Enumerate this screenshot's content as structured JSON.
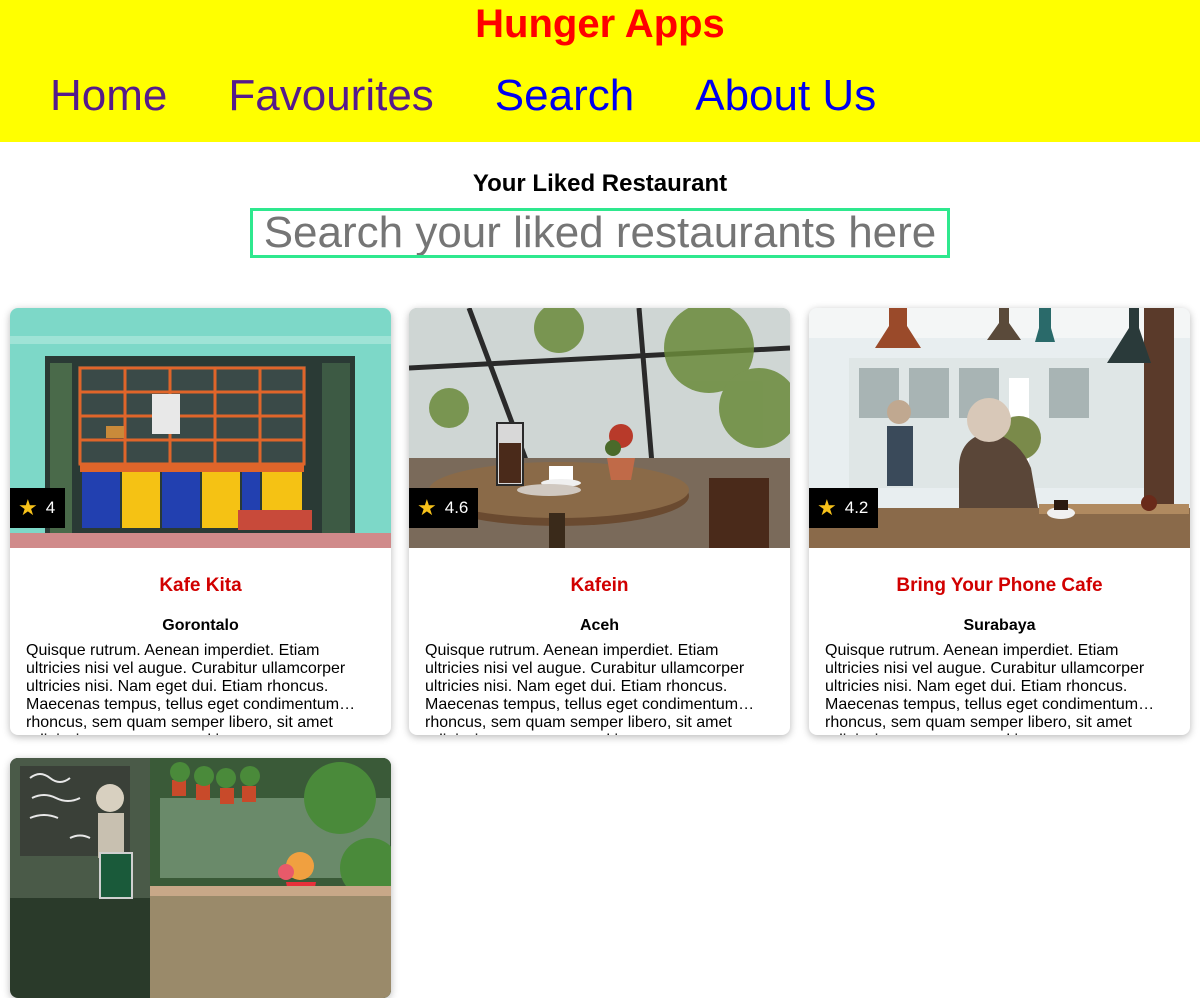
{
  "header": {
    "title": "Hunger Apps",
    "nav": [
      {
        "label": "Home",
        "state": "visited"
      },
      {
        "label": "Favourites",
        "state": "visited"
      },
      {
        "label": "Search",
        "state": "unvisited"
      },
      {
        "label": "About Us",
        "state": "unvisited"
      }
    ],
    "background_color": "#ffff00",
    "title_color": "#ff0000"
  },
  "main": {
    "title": "Your Liked Restaurant",
    "search": {
      "placeholder": "Search your liked restaurants here",
      "value": ""
    },
    "restaurants": [
      {
        "name": "Kafe Kita",
        "city": "Gorontalo",
        "rating": "4",
        "description": "Quisque rutrum. Aenean imperdiet. Etiam ultricies nisi vel augue. Curabitur ullamcorper ultricies nisi. Nam eget dui. Etiam rhoncus. Maecenas tempus, tellus eget condimentum rhoncus, sem quam semper libero, sit amet adipiscing sem neque sed ipsum."
      },
      {
        "name": "Kafein",
        "city": "Aceh",
        "rating": "4.6",
        "description": "Quisque rutrum. Aenean imperdiet. Etiam ultricies nisi vel augue. Curabitur ullamcorper ultricies nisi. Nam eget dui. Etiam rhoncus. Maecenas tempus, tellus eget condimentum rhoncus, sem quam semper libero, sit amet adipiscing sem neque sed ipsum."
      },
      {
        "name": "Bring Your Phone Cafe",
        "city": "Surabaya",
        "rating": "4.2",
        "description": "Quisque rutrum. Aenean imperdiet. Etiam ultricies nisi vel augue. Curabitur ullamcorper ultricies nisi. Nam eget dui. Etiam rhoncus. Maecenas tempus, tellus eget condimentum rhoncus, sem quam semper libero, sit amet adipiscing sem neque sed ipsum."
      },
      {
        "name": "",
        "city": "",
        "rating": "",
        "description": ""
      }
    ]
  },
  "icons": {
    "rating": "star-icon"
  },
  "colors": {
    "restaurant_name": "#d10000",
    "search_border": "#2ee88e",
    "star": "#f7c21a"
  }
}
